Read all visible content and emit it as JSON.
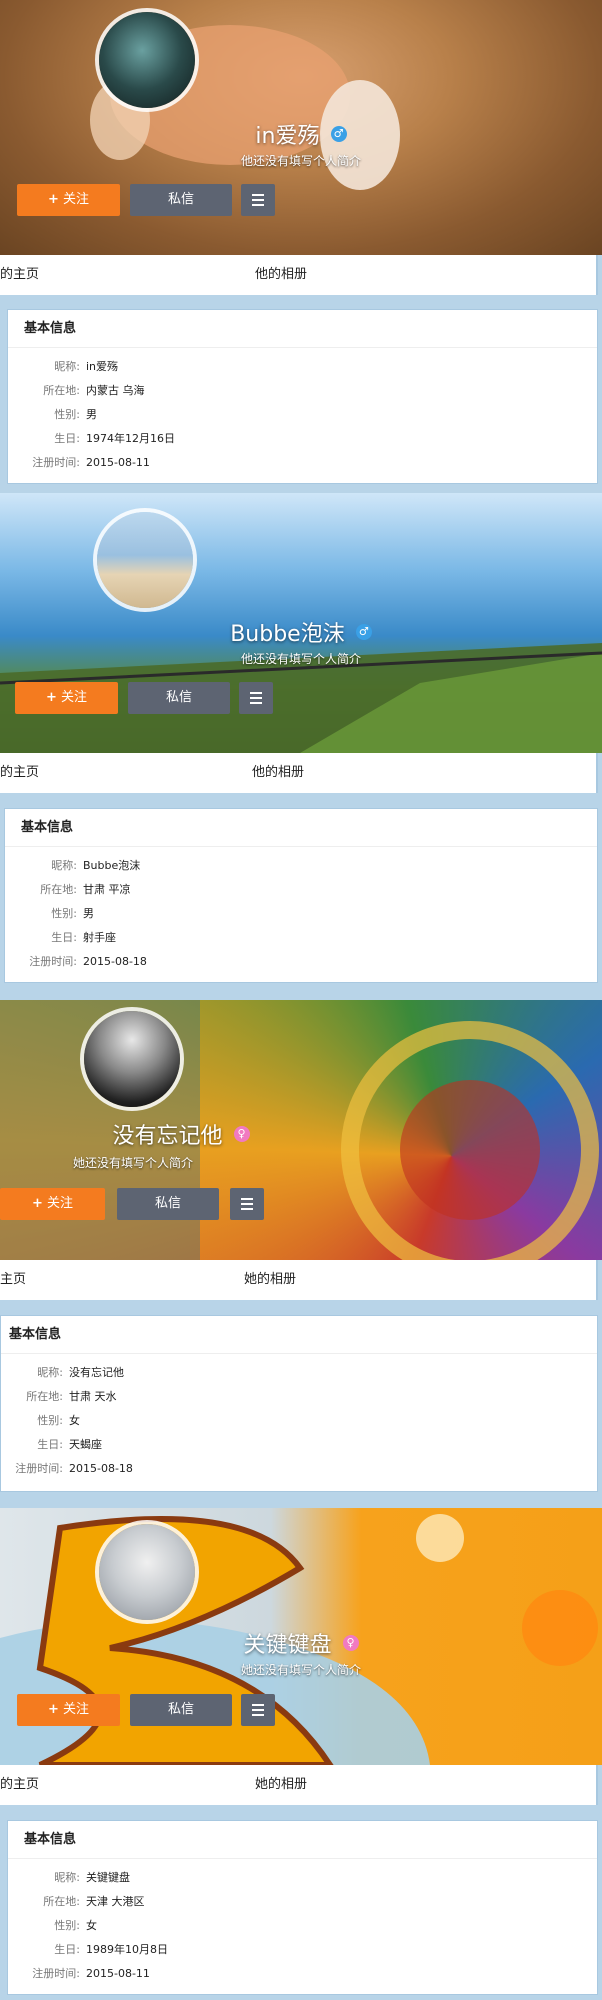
{
  "profiles": [
    {
      "name": "in爱殇",
      "gender": "male",
      "gender_glyph": "♂",
      "bio": "他还没有填写个人简介",
      "follow_label": "关注",
      "message_label": "私信",
      "tab_home": "的主页",
      "tab_album": "他的相册",
      "info": {
        "title": "基本信息",
        "rows": [
          {
            "label": "昵称:",
            "value": "in爱殇"
          },
          {
            "label": "所在地:",
            "value": "内蒙古 乌海"
          },
          {
            "label": "性别:",
            "value": "男"
          },
          {
            "label": "生日:",
            "value": "1974年12月16日"
          },
          {
            "label": "注册时间:",
            "value": "2015-08-11"
          }
        ]
      }
    },
    {
      "name": "Bubbe泡沫",
      "gender": "male",
      "gender_glyph": "♂",
      "bio": "他还没有填写个人简介",
      "follow_label": "关注",
      "message_label": "私信",
      "tab_home": "的主页",
      "tab_album": "他的相册",
      "info": {
        "title": "基本信息",
        "rows": [
          {
            "label": "昵称:",
            "value": "Bubbe泡沫"
          },
          {
            "label": "所在地:",
            "value": "甘肃 平凉"
          },
          {
            "label": "性别:",
            "value": "男"
          },
          {
            "label": "生日:",
            "value": "射手座"
          },
          {
            "label": "注册时间:",
            "value": "2015-08-18"
          }
        ]
      }
    },
    {
      "name": "没有忘记他",
      "gender": "female",
      "gender_glyph": "♀",
      "bio": "她还没有填写个人简介",
      "follow_label": "关注",
      "message_label": "私信",
      "tab_home": "主页",
      "tab_album": "她的相册",
      "info": {
        "title": "基本信息",
        "rows": [
          {
            "label": "昵称:",
            "value": "没有忘记他"
          },
          {
            "label": "所在地:",
            "value": "甘肃 天水"
          },
          {
            "label": "性别:",
            "value": "女"
          },
          {
            "label": "生日:",
            "value": "天蝎座"
          },
          {
            "label": "注册时间:",
            "value": "2015-08-18"
          }
        ]
      }
    },
    {
      "name": "关键键盘",
      "gender": "female",
      "gender_glyph": "♀",
      "bio": "她还没有填写个人简介",
      "follow_label": "关注",
      "message_label": "私信",
      "tab_home": "的主页",
      "tab_album": "她的相册",
      "info": {
        "title": "基本信息",
        "rows": [
          {
            "label": "昵称:",
            "value": "关键键盘"
          },
          {
            "label": "所在地:",
            "value": "天津 大港区"
          },
          {
            "label": "性别:",
            "value": "女"
          },
          {
            "label": "生日:",
            "value": "1989年10月8日"
          },
          {
            "label": "注册时间:",
            "value": "2015-08-11"
          }
        ]
      }
    }
  ],
  "colors": {
    "follow": "#f47b1f",
    "message": "#5d6472",
    "male": "#3aa0e6",
    "female": "#f17ac1",
    "page_bg": "#b8d4e8"
  },
  "icons": [
    "avatar",
    "male-icon",
    "female-icon",
    "plus-icon",
    "menu-icon"
  ]
}
